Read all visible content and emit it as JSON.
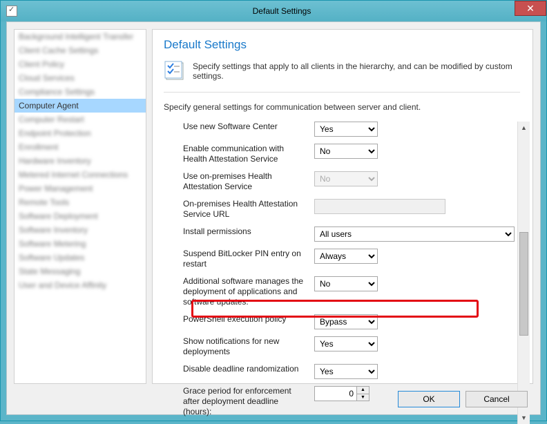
{
  "window": {
    "title": "Default Settings"
  },
  "sidebar": {
    "items": [
      {
        "label": "Background Intelligent Transfer",
        "blurred": true
      },
      {
        "label": "Client Cache Settings",
        "blurred": true
      },
      {
        "label": "Client Policy",
        "blurred": true
      },
      {
        "label": "Cloud Services",
        "blurred": true
      },
      {
        "label": "Compliance Settings",
        "blurred": true
      },
      {
        "label": "Computer Agent",
        "blurred": false,
        "selected": true
      },
      {
        "label": "Computer Restart",
        "blurred": true
      },
      {
        "label": "Endpoint Protection",
        "blurred": true
      },
      {
        "label": "Enrollment",
        "blurred": true
      },
      {
        "label": "Hardware Inventory",
        "blurred": true
      },
      {
        "label": "Metered Internet Connections",
        "blurred": true
      },
      {
        "label": "Power Management",
        "blurred": true
      },
      {
        "label": "Remote Tools",
        "blurred": true
      },
      {
        "label": "Software Deployment",
        "blurred": true
      },
      {
        "label": "Software Inventory",
        "blurred": true
      },
      {
        "label": "Software Metering",
        "blurred": true
      },
      {
        "label": "Software Updates",
        "blurred": true
      },
      {
        "label": "State Messaging",
        "blurred": true
      },
      {
        "label": "User and Device Affinity",
        "blurred": true
      }
    ]
  },
  "main": {
    "heading": "Default Settings",
    "intro": "Specify settings that apply to all clients in the hierarchy, and can be modified by custom settings.",
    "sub_intro": "Specify general settings for communication between server and client.",
    "settings": [
      {
        "label": "Use new Software Center",
        "type": "select-small",
        "value": "Yes",
        "disabled": false
      },
      {
        "label": "Enable communication with Health Attestation Service",
        "type": "select-small",
        "value": "No",
        "disabled": false
      },
      {
        "label": "Use on-premises Health Attestation Service",
        "type": "select-small",
        "value": "No",
        "disabled": true
      },
      {
        "label": "On-premises Health Attestation Service URL",
        "type": "text",
        "value": "",
        "disabled": true
      },
      {
        "label": "Install permissions",
        "type": "select-wide",
        "value": "All users",
        "disabled": false
      },
      {
        "label": "Suspend BitLocker PIN entry on restart",
        "type": "select-small",
        "value": "Always",
        "disabled": false
      },
      {
        "label": "Additional software manages the deployment of applications and software updates.",
        "type": "select-small",
        "value": "No",
        "disabled": false
      },
      {
        "label": "PowerShell execution policy",
        "type": "select-small",
        "value": "Bypass",
        "disabled": false,
        "highlighted": true
      },
      {
        "label": "Show notifications for new deployments",
        "type": "select-small",
        "value": "Yes",
        "disabled": false
      },
      {
        "label": "Disable deadline randomization",
        "type": "select-small",
        "value": "Yes",
        "disabled": false
      },
      {
        "label": "Grace period for enforcement after deployment deadline (hours):",
        "type": "spinner",
        "value": "0",
        "disabled": false
      }
    ]
  },
  "buttons": {
    "ok": "OK",
    "cancel": "Cancel"
  }
}
